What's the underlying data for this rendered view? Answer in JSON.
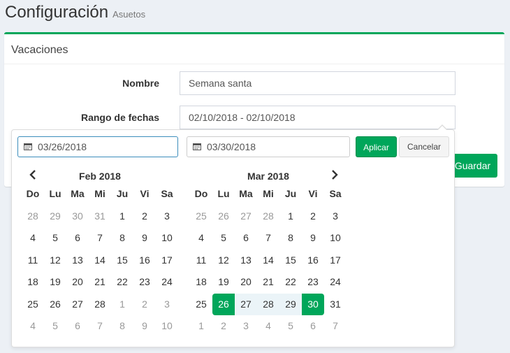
{
  "header": {
    "title": "Configuración",
    "subtitle": "Asuetos"
  },
  "box": {
    "title": "Vacaciones",
    "name_label": "Nombre",
    "name_value": "Semana santa",
    "range_label": "Rango de fechas",
    "range_value": "02/10/2018 - 02/10/2018",
    "save_label": "Guardar"
  },
  "picker": {
    "start_input": "03/26/2018",
    "end_input": "03/30/2018",
    "apply_label": "Aplicar",
    "cancel_label": "Cancelar",
    "weekdays": [
      "Do",
      "Lu",
      "Ma",
      "Mi",
      "Ju",
      "Vi",
      "Sa"
    ],
    "months": [
      {
        "title": "Feb 2018",
        "weeks": [
          [
            "28",
            "29",
            "30",
            "31",
            "1",
            "2",
            "3"
          ],
          [
            "4",
            "5",
            "6",
            "7",
            "8",
            "9",
            "10"
          ],
          [
            "11",
            "12",
            "13",
            "14",
            "15",
            "16",
            "17"
          ],
          [
            "18",
            "19",
            "20",
            "21",
            "22",
            "23",
            "24"
          ],
          [
            "25",
            "26",
            "27",
            "28",
            "1",
            "2",
            "3"
          ],
          [
            "4",
            "5",
            "6",
            "7",
            "8",
            "9",
            "10"
          ]
        ],
        "off": [
          [
            0,
            0
          ],
          [
            0,
            1
          ],
          [
            0,
            2
          ],
          [
            0,
            3
          ],
          [
            4,
            4
          ],
          [
            4,
            5
          ],
          [
            4,
            6
          ],
          [
            5,
            0
          ],
          [
            5,
            1
          ],
          [
            5,
            2
          ],
          [
            5,
            3
          ],
          [
            5,
            4
          ],
          [
            5,
            5
          ],
          [
            5,
            6
          ]
        ]
      },
      {
        "title": "Mar 2018",
        "weeks": [
          [
            "25",
            "26",
            "27",
            "28",
            "1",
            "2",
            "3"
          ],
          [
            "4",
            "5",
            "6",
            "7",
            "8",
            "9",
            "10"
          ],
          [
            "11",
            "12",
            "13",
            "14",
            "15",
            "16",
            "17"
          ],
          [
            "18",
            "19",
            "20",
            "21",
            "22",
            "23",
            "24"
          ],
          [
            "25",
            "26",
            "27",
            "28",
            "29",
            "30",
            "31"
          ],
          [
            "1",
            "2",
            "3",
            "4",
            "5",
            "6",
            "7"
          ]
        ],
        "off": [
          [
            0,
            0
          ],
          [
            0,
            1
          ],
          [
            0,
            2
          ],
          [
            0,
            3
          ],
          [
            5,
            0
          ],
          [
            5,
            1
          ],
          [
            5,
            2
          ],
          [
            5,
            3
          ],
          [
            5,
            4
          ],
          [
            5,
            5
          ],
          [
            5,
            6
          ]
        ],
        "range_start": [
          4,
          1
        ],
        "range_end": [
          4,
          5
        ]
      }
    ]
  },
  "colors": {
    "accent": "#00a65a",
    "in_range": "#ebf4f8",
    "focus_border": "#3c8dbc"
  }
}
